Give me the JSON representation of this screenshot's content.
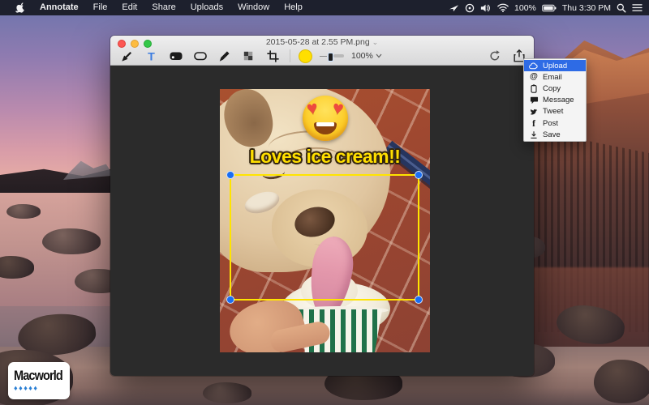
{
  "menu_bar": {
    "app_name": "Annotate",
    "menus": [
      "File",
      "Edit",
      "Share",
      "Uploads",
      "Window",
      "Help"
    ],
    "battery_percent": "100%",
    "clock": "Thu 3:30 PM"
  },
  "window": {
    "title": "2015-05-28 at 2.55 PM.png",
    "zoom_level": "100%",
    "tools": [
      "arrow",
      "text",
      "filled-rect",
      "outline-rect",
      "pencil",
      "pixelate",
      "crop",
      "color",
      "thickness-slider",
      "zoom",
      "rotate",
      "share"
    ]
  },
  "share_menu": {
    "selected": "Upload",
    "highlight_color": "#2e6be5",
    "items": [
      {
        "label": "Upload",
        "icon": "cloud-icon"
      },
      {
        "label": "Email",
        "icon": "at-icon"
      },
      {
        "label": "Copy",
        "icon": "clipboard-icon"
      },
      {
        "label": "Message",
        "icon": "speech-bubble-icon"
      },
      {
        "label": "Tweet",
        "icon": "twitter-bird-icon"
      },
      {
        "label": "Post",
        "icon": "facebook-icon"
      },
      {
        "label": "Save",
        "icon": "download-icon"
      }
    ]
  },
  "icon_glyphs": {
    "email": "@",
    "post": "f",
    "heart": "♥",
    "mouse": "♦",
    "title_caret": "⌄"
  },
  "annotation": {
    "caption": "Loves ice cream!!",
    "caption_color": "#ffdf00",
    "selection_color": "#ffe400",
    "handle_color": "#1a6df2"
  },
  "logo": {
    "text": "Macworld"
  },
  "colors": {
    "canvas": "#2b2b2b",
    "menu_highlight": "#2e6be5",
    "accent_yellow": "#ffdf00"
  }
}
